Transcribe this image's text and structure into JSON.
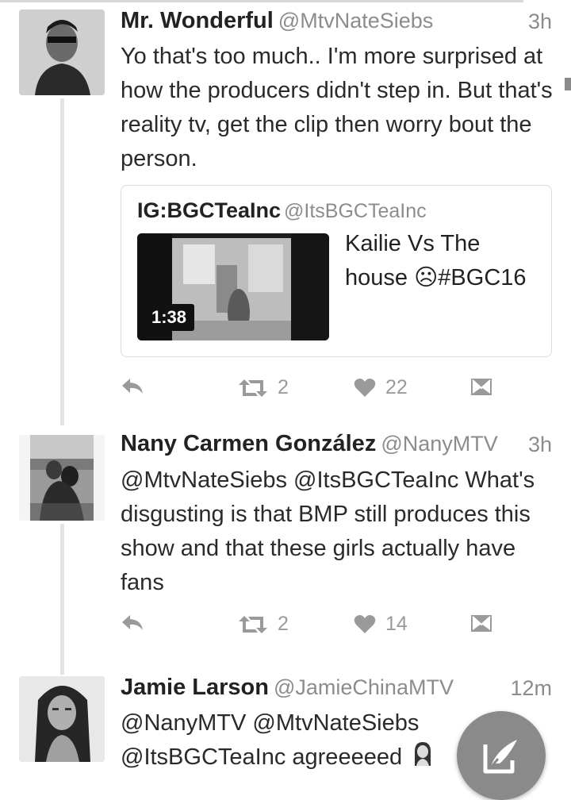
{
  "tweets": [
    {
      "name": "Mr. Wonderful",
      "handle": "@MtvNateSiebs",
      "time": "3h",
      "text": "Yo that's too much.. I'm more surprised at how the producers didn't step in. But that's reality tv, get the clip then worry bout the person.",
      "card": {
        "name": "IG:BGCTeaInc",
        "handle": "@ItsBGCTeaInc",
        "duration": "1:38",
        "title": "Kailie Vs The house ☹#BGC16"
      },
      "retweets": "2",
      "likes": "22"
    },
    {
      "name": "Nany Carmen González",
      "handle": "@NanyMTV",
      "time": "3h",
      "text": "@MtvNateSiebs @ItsBGCTeaInc What's disgusting is that BMP still produces this show and that these girls actually have fans",
      "retweets": "2",
      "likes": "14"
    },
    {
      "name": "Jamie Larson",
      "handle": "@JamieChinaMTV",
      "time": "12m",
      "text": "@NanyMTV @MtvNateSiebs @ItsBGCTeaInc agreeeeed"
    }
  ],
  "icons": {
    "reply": "reply-icon",
    "retweet": "retweet-icon",
    "like": "heart-icon",
    "dm": "direct-message-icon",
    "compose": "compose-tweet-icon"
  },
  "colors": {
    "icon": "#9a9a9a",
    "fab": "#8a8a8a"
  }
}
